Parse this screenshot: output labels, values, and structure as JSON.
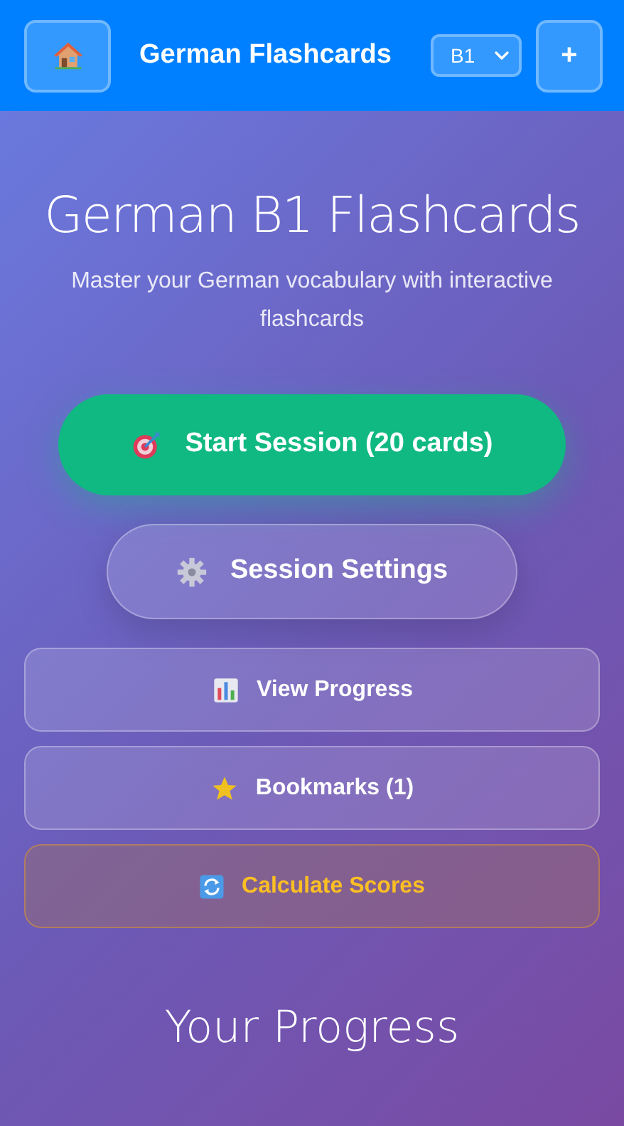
{
  "header": {
    "title": "German Flashcards",
    "level_select": {
      "value": "B1"
    },
    "add_button": {
      "label": "+"
    }
  },
  "hero": {
    "title": "German B1 Flashcards",
    "subtitle": "Master your German vocabulary with interactive flashcards"
  },
  "primary_actions": [
    {
      "kind": "start",
      "label": "Start Session (20 cards)"
    },
    {
      "kind": "settings",
      "label": "Session Settings"
    }
  ],
  "menu_buttons": [
    {
      "kind": "progress",
      "label": "View Progress"
    },
    {
      "kind": "bookmarks",
      "label": "Bookmarks (1)"
    },
    {
      "kind": "calculate",
      "label": "Calculate Scores"
    }
  ],
  "section_title": "Your Progress"
}
